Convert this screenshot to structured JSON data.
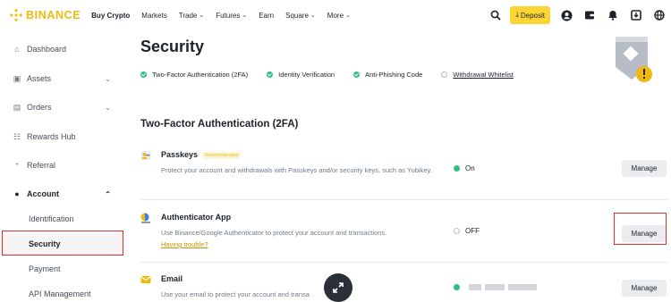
{
  "brand": {
    "name": "BINANCE",
    "color": "#f0b90b"
  },
  "nav": {
    "items": [
      {
        "label": "Buy Crypto",
        "chevron": false
      },
      {
        "label": "Markets",
        "chevron": false
      },
      {
        "label": "Trade",
        "chevron": true
      },
      {
        "label": "Futures",
        "chevron": true
      },
      {
        "label": "Earn",
        "chevron": false
      },
      {
        "label": "Square",
        "chevron": true
      },
      {
        "label": "More",
        "chevron": true
      }
    ],
    "deposit_label": "Deposit",
    "icons": [
      "search-icon",
      "profile-icon",
      "wallet-icon",
      "notification-icon",
      "download-icon",
      "globe-icon"
    ]
  },
  "sidebar": {
    "items": [
      {
        "label": "Dashboard",
        "icon": "home-icon"
      },
      {
        "label": "Assets",
        "icon": "wallet-icon",
        "chevron": "⌄"
      },
      {
        "label": "Orders",
        "icon": "orders-icon",
        "chevron": "⌄"
      },
      {
        "label": "Rewards Hub",
        "icon": "rewards-icon"
      },
      {
        "label": "Referral",
        "icon": "referral-icon"
      },
      {
        "label": "Account",
        "icon": "account-icon",
        "chevron": "⌃"
      }
    ],
    "subitems": [
      {
        "label": "Identification"
      },
      {
        "label": "Security",
        "active": true
      },
      {
        "label": "Payment"
      },
      {
        "label": "API Management"
      }
    ]
  },
  "main": {
    "title": "Security",
    "checks": [
      {
        "label": "Two-Factor Authentication (2FA)",
        "done": true
      },
      {
        "label": "Identity Verification",
        "done": true
      },
      {
        "label": "Anti-Phishing Code",
        "done": true
      },
      {
        "label": "Withdrawal Whitelist",
        "done": false
      }
    ],
    "section_title": "Two-Factor Authentication (2FA)",
    "rows": [
      {
        "name": "Passkeys",
        "badge": "Recommended",
        "description": "Protect your account and withdrawals with Passkeys and/or security keys, such as Yubikey.",
        "status": "On",
        "button": "Manage"
      },
      {
        "name": "Authenticator App",
        "description": "Use Binance/Google Authenticator to protect your account and transactions.",
        "link": "Having trouble?",
        "status": "OFF",
        "button": "Manage"
      },
      {
        "name": "Email",
        "description": "Use your email to protect your account and transa",
        "status": "",
        "button": "Manage"
      }
    ]
  },
  "colors": {
    "accent": "#f0b90b",
    "success": "#2ebd85",
    "highlight": "#e02f2f",
    "button_bg": "#eaecef"
  }
}
